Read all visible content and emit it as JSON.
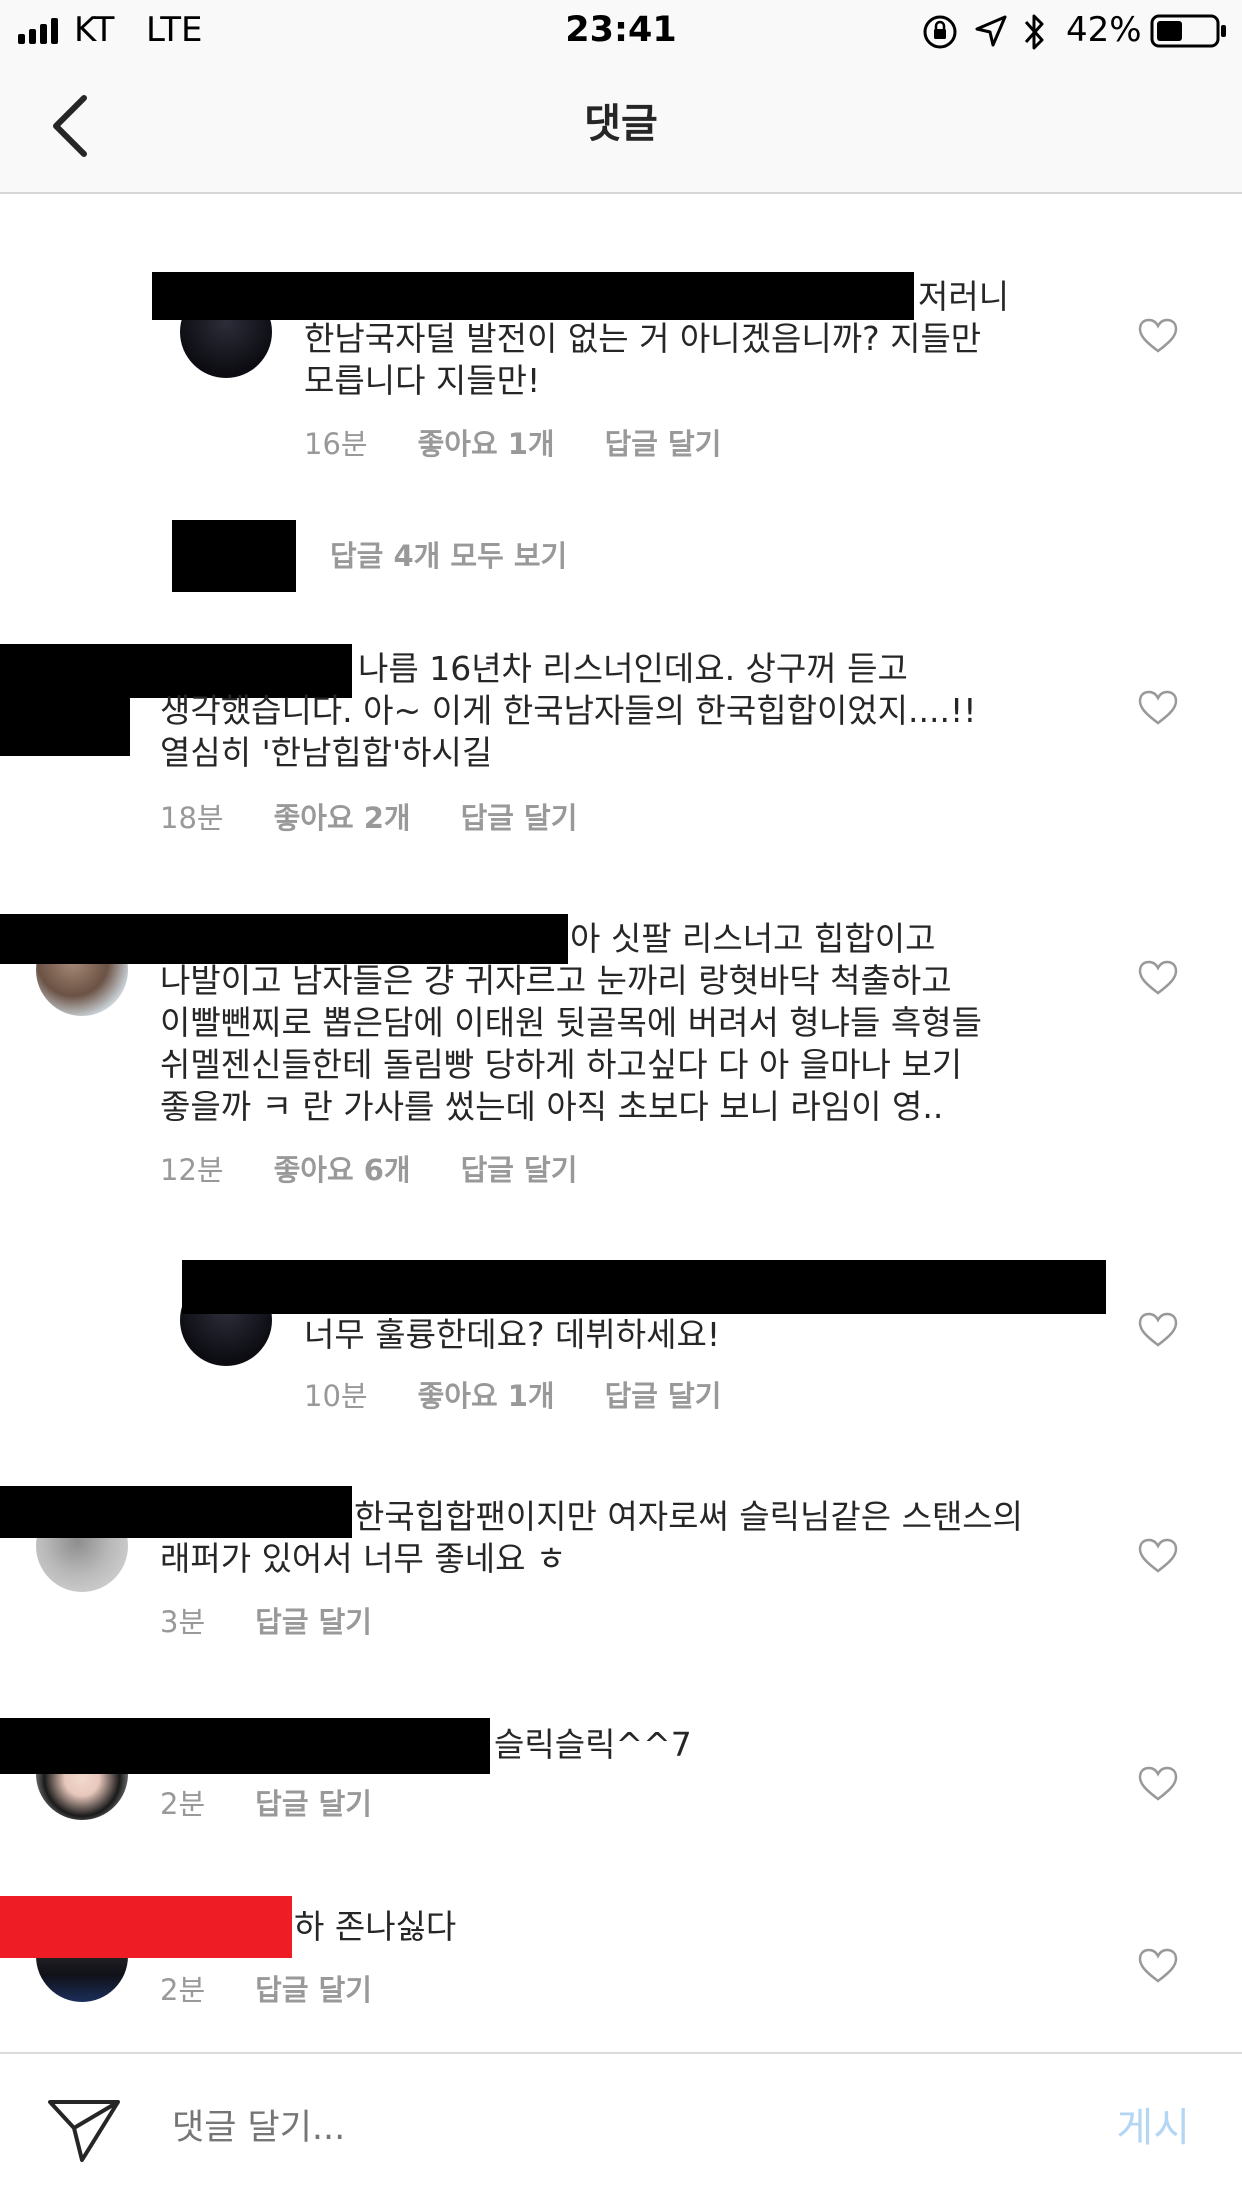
{
  "status_bar": {
    "carrier": "KT",
    "network": "LTE",
    "time": "23:41",
    "battery": "42%"
  },
  "nav": {
    "title": "댓글"
  },
  "comments": [
    {
      "text_lines": [
        "저러니",
        "한남국자덜 발전이 없는 거 아니겠음니까? 지들만",
        "모릅니다 지들만!"
      ],
      "time": "16분",
      "likes": "좋아요 1개",
      "reply": "답글 달기"
    },
    {
      "view_replies": "답글 4개 모두 보기"
    },
    {
      "text_lines": [
        "나름 16년차 리스너인데요. 상구꺼 듣고",
        "생각했습니다. 아~ 이게 한국남자들의 한국힙합이었지....!!",
        "열심히 '한남힙합'하시길"
      ],
      "time": "18분",
      "likes": "좋아요 2개",
      "reply": "답글 달기"
    },
    {
      "text_lines": [
        "아 싯팔 리스너고 힙합이고",
        "나발이고 남자들은 걍 귀자르고 눈까리 랑혓바닥 척출하고",
        "이빨뺀찌로 뽑은담에 이태원 뒷골목에 버려서 형냐들 흑형들",
        "쉬멜젠신들한테 돌림빵 당하게 하고싶다 다 아 을마나 보기",
        "좋을까 ㅋ 란 가사를 썼는데 아직 초보다 보니 라임이 영.."
      ],
      "time": "12분",
      "likes": "좋아요 6개",
      "reply": "답글 달기"
    },
    {
      "text_lines": [
        "너무 훌륭한데요? 데뷔하세요!"
      ],
      "time": "10분",
      "likes": "좋아요 1개",
      "reply": "답글 달기"
    },
    {
      "text_lines": [
        "한국힙합팬이지만 여자로써 슬릭님같은 스탠스의",
        "래퍼가 있어서 너무 좋네요 ㅎ"
      ],
      "time": "3분",
      "reply": "답글 달기"
    },
    {
      "text_lines": [
        "슬릭슬릭^^7"
      ],
      "time": "2분",
      "reply": "답글 달기"
    },
    {
      "text_lines": [
        "하 존나싫다"
      ],
      "time": "2분",
      "reply": "답글 달기"
    }
  ],
  "composer": {
    "placeholder": "댓글 달기...",
    "post_label": "게시"
  },
  "colors": {
    "text": "#262626",
    "muted": "#999999",
    "post_disabled": "#b4d6f5",
    "redaction_red": "#ee1c25"
  }
}
